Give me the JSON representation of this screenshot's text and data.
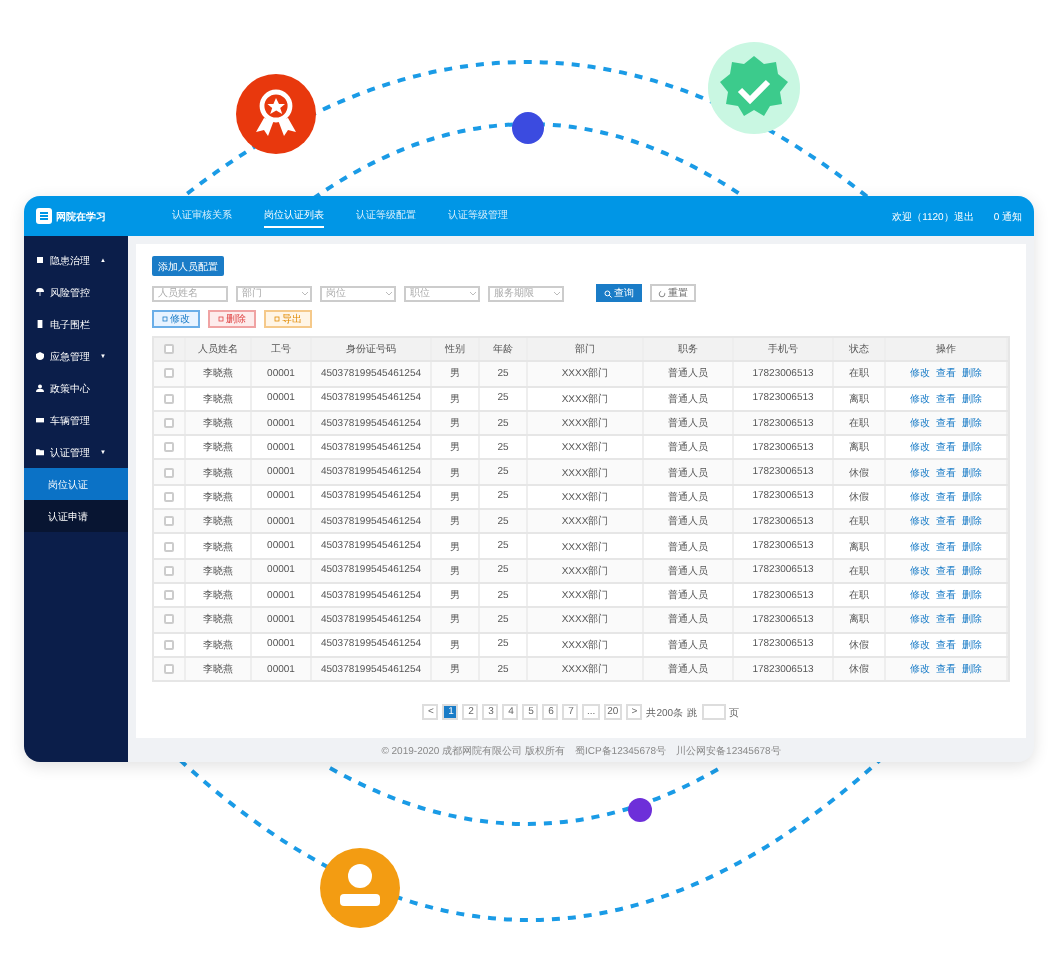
{
  "header": {
    "logo": "网院在学习",
    "nav": [
      {
        "label": "认证审核关系",
        "selected": false
      },
      {
        "label": "岗位认证列表",
        "selected": true
      },
      {
        "label": "认证等级配置",
        "selected": false
      },
      {
        "label": "认证等级管理",
        "selected": false
      }
    ],
    "user": "欢迎（1120）退出",
    "notice": "0 通知"
  },
  "sidebar": [
    {
      "label": "隐患治理",
      "caret": "▲",
      "selected": false
    },
    {
      "label": "风险管控",
      "selected": false
    },
    {
      "label": "电子围栏",
      "selected": false
    },
    {
      "label": "应急管理",
      "caret": "▼",
      "selected": false
    },
    {
      "label": "政策中心",
      "selected": false
    },
    {
      "label": "车辆管理",
      "selected": false
    },
    {
      "label": "认证管理",
      "caret": "▼",
      "selected": false,
      "children": [
        {
          "label": "岗位认证",
          "selected": true
        },
        {
          "label": "认证申请",
          "selected": false
        }
      ]
    }
  ],
  "add_button": "添加人员配置",
  "filters": [
    {
      "kind": "input",
      "placeholder": "人员姓名"
    },
    {
      "kind": "select",
      "placeholder": "部门"
    },
    {
      "kind": "select",
      "placeholder": "岗位"
    },
    {
      "kind": "select",
      "placeholder": "职位"
    },
    {
      "kind": "select",
      "placeholder": "服务期限"
    }
  ],
  "search_button": "查询",
  "reset_button": "重置",
  "actions": [
    {
      "kind": "edit",
      "label": "修改"
    },
    {
      "kind": "delete",
      "label": "删除"
    },
    {
      "kind": "export",
      "label": "导出"
    }
  ],
  "table": {
    "header_checked": false,
    "columns": [
      "人员姓名",
      "工号",
      "身份证号码",
      "性别",
      "年龄",
      "部门",
      "职务",
      "手机号",
      "状态",
      "操作"
    ],
    "rows": [
      {
        "checked": false,
        "cells": [
          "李晓燕",
          "00001",
          "450378199545461254",
          "男",
          "25",
          "XXXX部门",
          "普通人员",
          "17823006513",
          "在职"
        ],
        "actions": [
          "修改",
          "查看",
          "删除"
        ]
      },
      {
        "checked": false,
        "cells": [
          "李晓燕",
          "00001",
          "450378199545461254",
          "男",
          "25",
          "XXXX部门",
          "普通人员",
          "17823006513",
          "离职"
        ],
        "actions": [
          "修改",
          "查看",
          "删除"
        ]
      },
      {
        "checked": false,
        "cells": [
          "李晓燕",
          "00001",
          "450378199545461254",
          "男",
          "25",
          "XXXX部门",
          "普通人员",
          "17823006513",
          "在职"
        ],
        "actions": [
          "修改",
          "查看",
          "删除"
        ]
      },
      {
        "checked": false,
        "cells": [
          "李晓燕",
          "00001",
          "450378199545461254",
          "男",
          "25",
          "XXXX部门",
          "普通人员",
          "17823006513",
          "离职"
        ],
        "actions": [
          "修改",
          "查看",
          "删除"
        ]
      },
      {
        "checked": false,
        "cells": [
          "李晓燕",
          "00001",
          "450378199545461254",
          "男",
          "25",
          "XXXX部门",
          "普通人员",
          "17823006513",
          "休假"
        ],
        "actions": [
          "修改",
          "查看",
          "删除"
        ]
      },
      {
        "checked": false,
        "cells": [
          "李晓燕",
          "00001",
          "450378199545461254",
          "男",
          "25",
          "XXXX部门",
          "普通人员",
          "17823006513",
          "休假"
        ],
        "actions": [
          "修改",
          "查看",
          "删除"
        ]
      },
      {
        "checked": false,
        "cells": [
          "李晓燕",
          "00001",
          "450378199545461254",
          "男",
          "25",
          "XXXX部门",
          "普通人员",
          "17823006513",
          "在职"
        ],
        "actions": [
          "修改",
          "查看",
          "删除"
        ]
      },
      {
        "checked": false,
        "cells": [
          "李晓燕",
          "00001",
          "450378199545461254",
          "男",
          "25",
          "XXXX部门",
          "普通人员",
          "17823006513",
          "离职"
        ],
        "actions": [
          "修改",
          "查看",
          "删除"
        ]
      },
      {
        "checked": false,
        "cells": [
          "李晓燕",
          "00001",
          "450378199545461254",
          "男",
          "25",
          "XXXX部门",
          "普通人员",
          "17823006513",
          "在职"
        ],
        "actions": [
          "修改",
          "查看",
          "删除"
        ]
      },
      {
        "checked": false,
        "cells": [
          "李晓燕",
          "00001",
          "450378199545461254",
          "男",
          "25",
          "XXXX部门",
          "普通人员",
          "17823006513",
          "在职"
        ],
        "actions": [
          "修改",
          "查看",
          "删除"
        ]
      },
      {
        "checked": false,
        "cells": [
          "李晓燕",
          "00001",
          "450378199545461254",
          "男",
          "25",
          "XXXX部门",
          "普通人员",
          "17823006513",
          "离职"
        ],
        "actions": [
          "修改",
          "查看",
          "删除"
        ]
      },
      {
        "checked": false,
        "cells": [
          "李晓燕",
          "00001",
          "450378199545461254",
          "男",
          "25",
          "XXXX部门",
          "普通人员",
          "17823006513",
          "休假"
        ],
        "actions": [
          "修改",
          "查看",
          "删除"
        ]
      },
      {
        "checked": false,
        "cells": [
          "李晓燕",
          "00001",
          "450378199545461254",
          "男",
          "25",
          "XXXX部门",
          "普通人员",
          "17823006513",
          "休假"
        ],
        "actions": [
          "修改",
          "查看",
          "删除"
        ]
      }
    ]
  },
  "pagination": {
    "prev": "<",
    "pages": [
      {
        "label": "1",
        "selected": true
      },
      {
        "label": "2",
        "selected": false
      },
      {
        "label": "3",
        "selected": false
      },
      {
        "label": "4",
        "selected": false
      },
      {
        "label": "5",
        "selected": false
      },
      {
        "label": "6",
        "selected": false
      },
      {
        "label": "7",
        "selected": false
      }
    ],
    "ellipsis": "...",
    "last": "20",
    "next": ">",
    "total": "共200条",
    "jump_label": "跳",
    "jump_suffix": "页"
  },
  "footer": "© 2019-2020 成都网院有限公司 版权所有　蜀ICP备12345678号　川公网安备12345678号"
}
